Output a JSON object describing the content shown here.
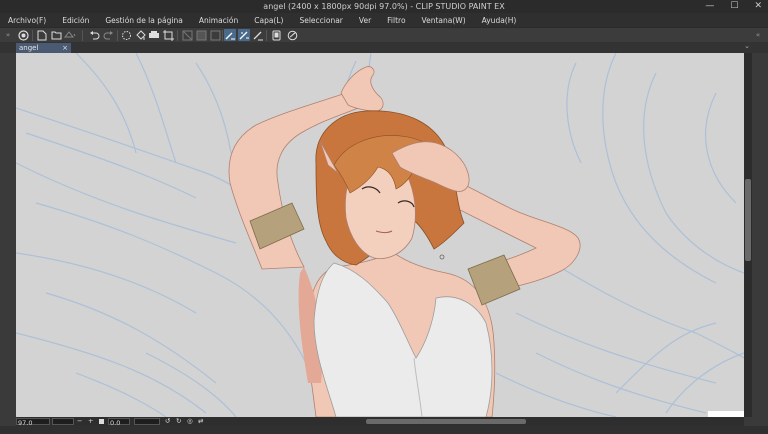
{
  "window": {
    "title": "angel (2400 x 1800px 90dpi 97.0%)  - CLIP STUDIO PAINT EX",
    "controls": [
      "—",
      "☐",
      "✕"
    ]
  },
  "menu": [
    "Archivo(F)",
    "Edición",
    "Gestión de la página",
    "Animación",
    "Capa(L)",
    "Seleccionar",
    "Ver",
    "Filtro",
    "Ventana(W)",
    "Ayuda(H)"
  ],
  "tab": {
    "label": "angel",
    "close": "×"
  },
  "status": {
    "zoom": "97.0",
    "rotation": "0.0"
  },
  "side_arrows": {
    "left": "»",
    "right": "«"
  },
  "colors": {
    "canvas_bg": "#d3d3d3",
    "skin": "#f1c8b5",
    "hair": "#c8763e",
    "armband": "#b5a27c",
    "top": "#ebebeb",
    "sketch_lines": "#a9bfd8",
    "active_tool": "#4a6a8c"
  }
}
